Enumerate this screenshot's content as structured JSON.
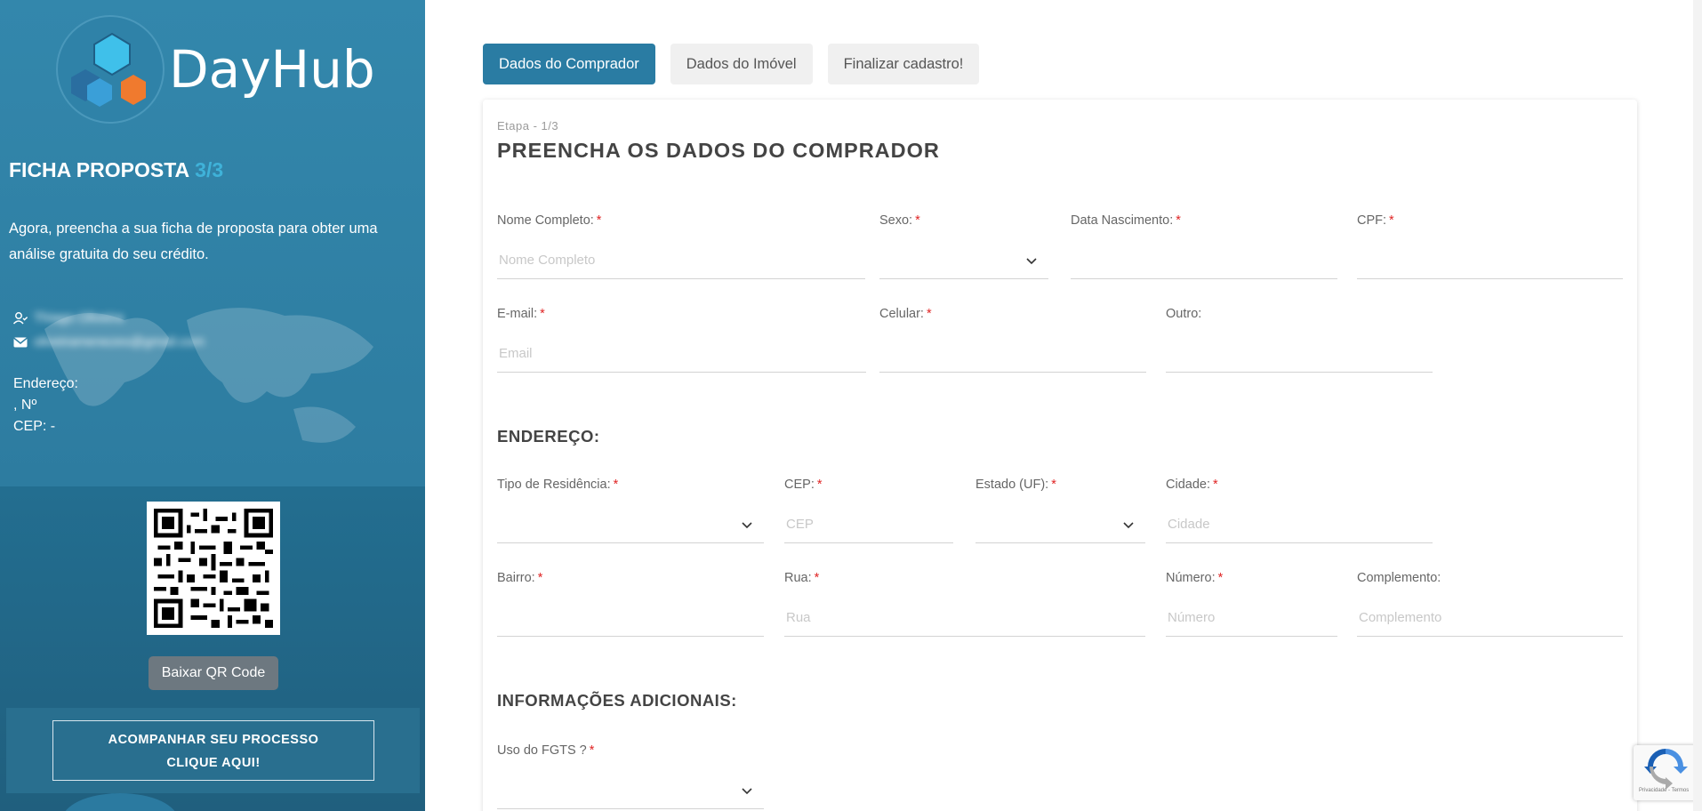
{
  "brand": {
    "name": "DayHub"
  },
  "sidebar": {
    "title": "FICHA PROPOSTA",
    "step": "3/3",
    "intro": "Agora, preencha a sua ficha de proposta para obter uma análise gratuita do seu crédito.",
    "contact": {
      "name": "Thiago Oliveira",
      "email": "oliveiramenezes@gmail.com"
    },
    "address": {
      "label": "Endereço:",
      "number_line": ", Nº",
      "cep_line": "CEP: -"
    },
    "qr_button": "Baixar QR Code",
    "follow_line1": "ACOMPANHAR SEU PROCESSO",
    "follow_line2": "CLIQUE AQUI!"
  },
  "tabs": [
    {
      "label": "Dados do Comprador",
      "active": true
    },
    {
      "label": "Dados do Imóvel",
      "active": false
    },
    {
      "label": "Finalizar cadastro!",
      "active": false
    }
  ],
  "form": {
    "etapa": "Etapa - 1/3",
    "title": "PREENCHA OS DADOS DO COMPRADOR",
    "fields": {
      "nome": {
        "label": "Nome Completo:",
        "placeholder": "Nome Completo",
        "value": ""
      },
      "sexo": {
        "label": "Sexo:",
        "value": ""
      },
      "nascimento": {
        "label": "Data Nascimento:",
        "value": ""
      },
      "cpf": {
        "label": "CPF:",
        "value": ""
      },
      "email": {
        "label": "E-mail:",
        "placeholder": "Email",
        "value": ""
      },
      "celular": {
        "label": "Celular:",
        "value": ""
      },
      "outro": {
        "label": "Outro:",
        "value": ""
      },
      "tipo_residencia": {
        "label": "Tipo de Residência:",
        "value": ""
      },
      "cep": {
        "label": "CEP:",
        "placeholder": "CEP",
        "value": ""
      },
      "estado": {
        "label": "Estado (UF):",
        "value": ""
      },
      "cidade": {
        "label": "Cidade:",
        "placeholder": "Cidade",
        "value": ""
      },
      "bairro": {
        "label": "Bairro:",
        "value": ""
      },
      "rua": {
        "label": "Rua:",
        "placeholder": "Rua",
        "value": ""
      },
      "numero": {
        "label": "Número:",
        "placeholder": "Número",
        "value": ""
      },
      "complemento": {
        "label": "Complemento:",
        "placeholder": "Complemento",
        "value": ""
      },
      "fgts": {
        "label": "Uso do FGTS ?",
        "value": ""
      }
    },
    "required_mark": "*",
    "address_title": "ENDEREÇO:",
    "additional_title": "INFORMAÇÕES ADICIONAIS:"
  },
  "recaptcha": {
    "footer": "Privacidade - Termos"
  },
  "colors": {
    "sidebar": "#2f7fa3",
    "sidebar_dark": "#236e90",
    "accent": "#2a7ca3",
    "required": "#e02424"
  }
}
